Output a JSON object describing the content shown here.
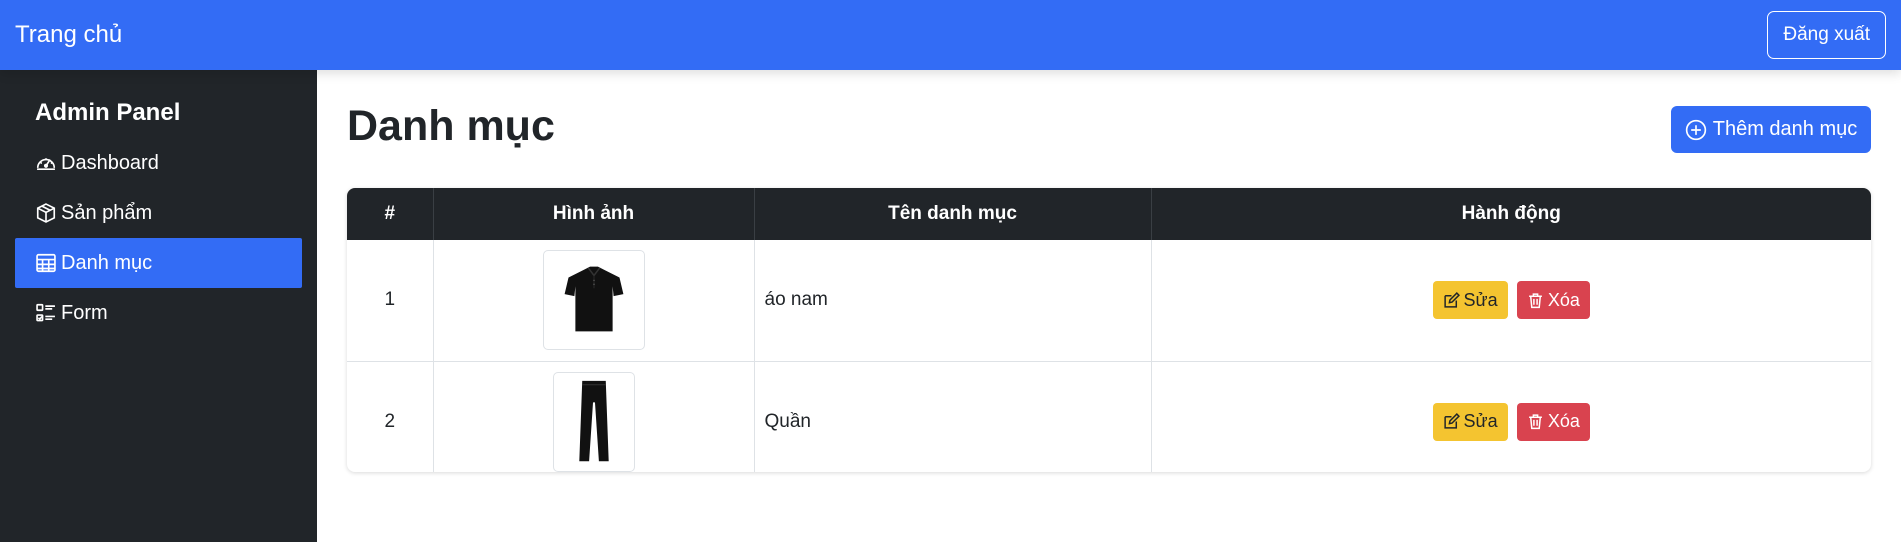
{
  "topbar": {
    "brand": "Trang chủ",
    "logout_label": "Đăng xuất"
  },
  "sidebar": {
    "title": "Admin Panel",
    "items": [
      {
        "label": "Dashboard",
        "icon": "speedometer-icon",
        "active": false
      },
      {
        "label": "Sản phẩm",
        "icon": "box-icon",
        "active": false
      },
      {
        "label": "Danh mục",
        "icon": "table-icon",
        "active": true
      },
      {
        "label": "Form",
        "icon": "checklist-icon",
        "active": false
      }
    ]
  },
  "main": {
    "title": "Danh mục",
    "add_label": "Thêm danh mục",
    "table": {
      "headers": [
        "#",
        "Hình ảnh",
        "Tên danh mục",
        "Hành động"
      ],
      "rows": [
        {
          "index": "1",
          "image": "black-polo-shirt",
          "name": "áo nam",
          "edit_label": "Sửa",
          "delete_label": "Xóa"
        },
        {
          "index": "2",
          "image": "black-pants",
          "name": "Quần",
          "edit_label": "Sửa",
          "delete_label": "Xóa"
        }
      ]
    }
  },
  "colors": {
    "primary": "#336cf5",
    "sidebar_bg": "#212529",
    "edit": "#f4c430",
    "delete": "#d9434f"
  }
}
